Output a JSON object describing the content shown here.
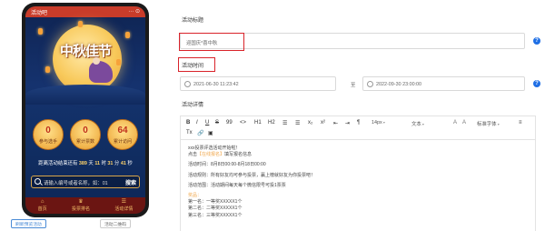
{
  "phone": {
    "app_title": "活动吧",
    "status_icons": "··· ⊙",
    "festival_title": "中秋佳节",
    "stats": [
      {
        "value": "0",
        "label": "参与选手"
      },
      {
        "value": "0",
        "label": "累计票数"
      },
      {
        "value": "64",
        "label": "累计访问"
      }
    ],
    "countdown": {
      "prefix": "距离活动结束还有",
      "days": "389",
      "d_unit": "天",
      "hours": "11",
      "h_unit": "时",
      "minutes": "31",
      "m_unit": "分",
      "seconds": "41",
      "s_unit": "秒"
    },
    "search_placeholder": "请输入编号或者名称，如：01",
    "search_button": "搜索",
    "tabs": [
      {
        "icon": "⌂",
        "label": "首页"
      },
      {
        "icon": "♛",
        "label": "投票排名"
      },
      {
        "icon": "☰",
        "label": "活动详情"
      }
    ],
    "below_buttons": [
      "刷新预览活动",
      "活动二维码"
    ]
  },
  "form": {
    "title_label": "活动标题",
    "title_value": "迎国庆*喜中秋",
    "time_label": "活动时间",
    "start_time": "2021-06-30 11:23:42",
    "to_label": "至",
    "end_time": "2022-09-30 23:00:00",
    "details_label": "活动详情",
    "help_icon_text": "?"
  },
  "editor": {
    "toolbar_row1": [
      "B",
      "I",
      "U",
      "S",
      "99",
      "<>",
      "H1",
      "H2",
      "☰",
      "☰",
      "x₂",
      "x²",
      "⇤",
      "⇥",
      "¶"
    ],
    "font_size": "14px",
    "text_type": "文本",
    "font_family": "标准字体",
    "align_icon": "≡",
    "toolbar_row2": [
      "Tx",
      "🔗",
      "▣"
    ],
    "content": [
      {
        "text": "xxx投票评选活动开始啦！",
        "style": ""
      },
      {
        "text": "点击【在线报名】填写报名信息",
        "style": "mixed"
      },
      {
        "text": "活动时间：8月8日00:00-8月18日00:00",
        "style": ""
      },
      {
        "text": "活动规则：所有好友均可参与投票，赢上榜就好友为你投票吧！",
        "style": ""
      },
      {
        "text": "活动范围：活动期间每天每个微信限号可投1票票",
        "style": ""
      },
      {
        "text": "奖品：",
        "style": "orange"
      },
      {
        "text": "第一名：一等奖XXXXX1个",
        "style": ""
      },
      {
        "text": "第二名：二等奖XXXXX1个",
        "style": ""
      },
      {
        "text": "第三名：三等奖XXXXX1个",
        "style": ""
      }
    ],
    "signup_prefix": "点击",
    "signup_link": "【在线报名】",
    "signup_suffix": "填写报名信息"
  },
  "colors": {
    "highlight_red": "#d9232a",
    "help_blue": "#1f6fe5",
    "status_bar": "#c93c2a",
    "tabbar": "#6b1512"
  }
}
